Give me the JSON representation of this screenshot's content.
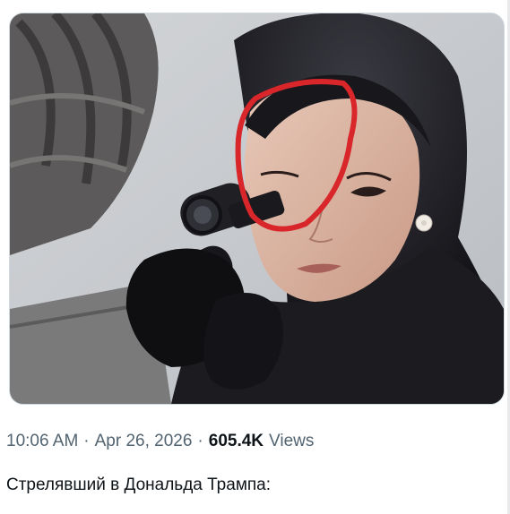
{
  "tweet": {
    "time": "10:06 AM",
    "separator": "·",
    "date": "Apr 26, 2026",
    "views_count": "605.4K",
    "views_label": "Views",
    "text": "Стрелявший в Дональда Трампа:"
  },
  "media": {
    "type": "photo",
    "annotation_color": "#d8262b"
  },
  "colors": {
    "meta_gray": "#536471",
    "text_dark": "#0f1419",
    "border": "#cfd9de"
  }
}
